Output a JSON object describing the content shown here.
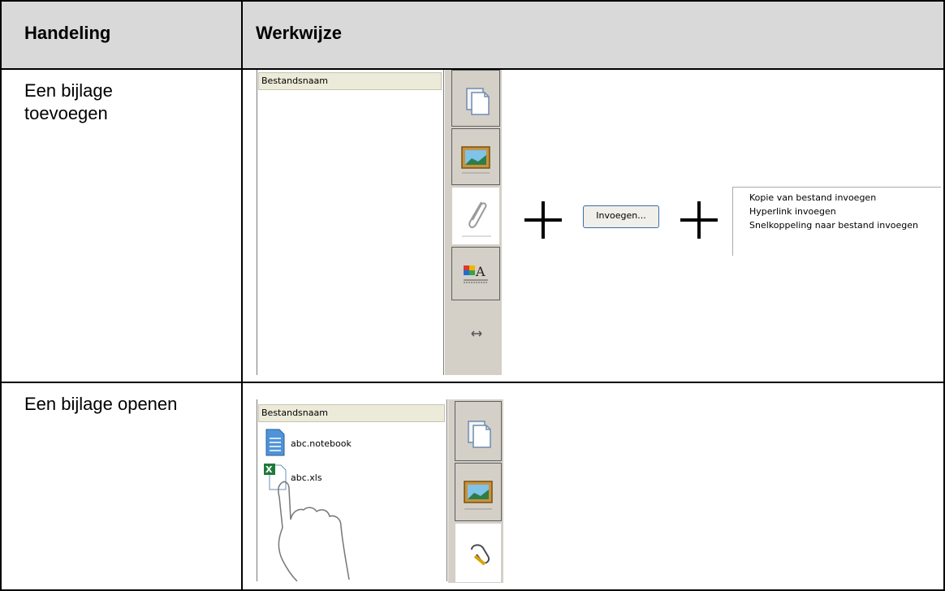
{
  "table": {
    "headers": [
      "Handeling",
      "Werkwijze"
    ],
    "rows": [
      {
        "action": [
          "Een bijlage",
          "toevoegen"
        ]
      },
      {
        "action": [
          "Een bijlage openen"
        ]
      }
    ]
  },
  "attachment_panel": {
    "column_header": "Bestandsnaam",
    "files": [
      "abc.notebook",
      "abc.xls"
    ]
  },
  "insert_button": {
    "label": "Invoegen..."
  },
  "insert_menu": {
    "items": [
      "Kopie van bestand invoegen",
      "Hyperlink invoegen",
      "Snelkoppeling naar bestand invoegen"
    ]
  },
  "icons": [
    "page-sorter-icon",
    "gallery-icon",
    "paperclip-icon",
    "properties-icon",
    "resize-arrows-icon",
    "excel-icon",
    "notebook-icon",
    "hand-pointer-icon"
  ],
  "colors": {
    "header_bg": "#d9d9d9",
    "tab_bg": "#d4d0c8",
    "panel_header_bg": "#ecead8"
  }
}
